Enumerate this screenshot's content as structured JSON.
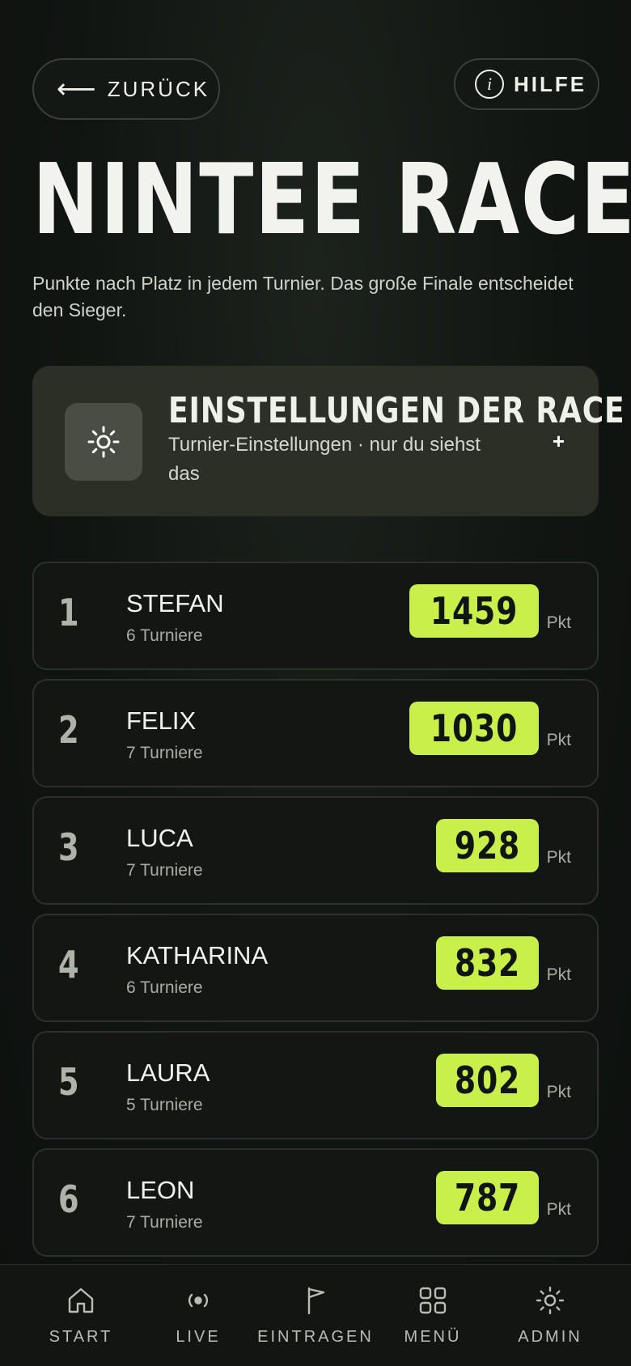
{
  "header": {
    "back_label": "ZURÜCK",
    "back_arrow": "⟵",
    "help_label": "HILFE",
    "help_icon": "i"
  },
  "title": "NINTEE RACE",
  "subtitle": "Punkte nach Platz in jedem Turnier. Das große Finale entscheidet den Sieger.",
  "settings": {
    "title": "EINSTELLUNGEN DER RACE",
    "subtitle": "Turnier-Einstellungen · nur du siehst das",
    "expand_symbol": "+"
  },
  "leaderboard": [
    {
      "rank": "1",
      "name": "STEFAN",
      "meta": "6 Turniere",
      "score": "1459",
      "unit": "Pkt"
    },
    {
      "rank": "2",
      "name": "FELIX",
      "meta": "7 Turniere",
      "score": "1030",
      "unit": "Pkt"
    },
    {
      "rank": "3",
      "name": "LUCA",
      "meta": "7 Turniere",
      "score": "928",
      "unit": "Pkt"
    },
    {
      "rank": "4",
      "name": "KATHARINA",
      "meta": "6 Turniere",
      "score": "832",
      "unit": "Pkt"
    },
    {
      "rank": "5",
      "name": "LAURA",
      "meta": "5 Turniere",
      "score": "802",
      "unit": "Pkt"
    },
    {
      "rank": "6",
      "name": "LEON",
      "meta": "7 Turniere",
      "score": "787",
      "unit": "Pkt"
    }
  ],
  "nav": [
    {
      "label": "START",
      "icon": "home-icon"
    },
    {
      "label": "LIVE",
      "icon": "live-icon"
    },
    {
      "label": "EINTRAGEN",
      "icon": "flag-icon"
    },
    {
      "label": "MENÜ",
      "icon": "grid-icon"
    },
    {
      "label": "ADMIN",
      "icon": "sun-gear-icon"
    }
  ],
  "colors": {
    "accent": "#c8ef4a",
    "background": "#111512",
    "card": "#2b2f26"
  }
}
